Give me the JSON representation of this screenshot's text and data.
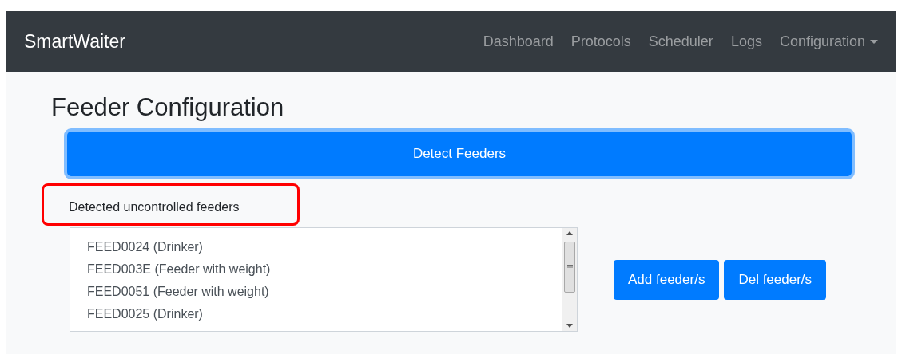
{
  "navbar": {
    "brand": "SmartWaiter",
    "items": [
      {
        "label": "Dashboard",
        "dropdown": false
      },
      {
        "label": "Protocols",
        "dropdown": false
      },
      {
        "label": "Scheduler",
        "dropdown": false
      },
      {
        "label": "Logs",
        "dropdown": false
      },
      {
        "label": "Configuration",
        "dropdown": true
      }
    ]
  },
  "page_title": "Feeder Configuration",
  "detect_button": "Detect Feeders",
  "list_label": "Detected uncontrolled feeders",
  "feeders": [
    "FEED0024 (Drinker)",
    "FEED003E (Feeder with weight)",
    "FEED0051 (Feeder with weight)",
    "FEED0025 (Drinker)"
  ],
  "buttons": [
    "Add feeder/s",
    "Del feeder/s"
  ]
}
